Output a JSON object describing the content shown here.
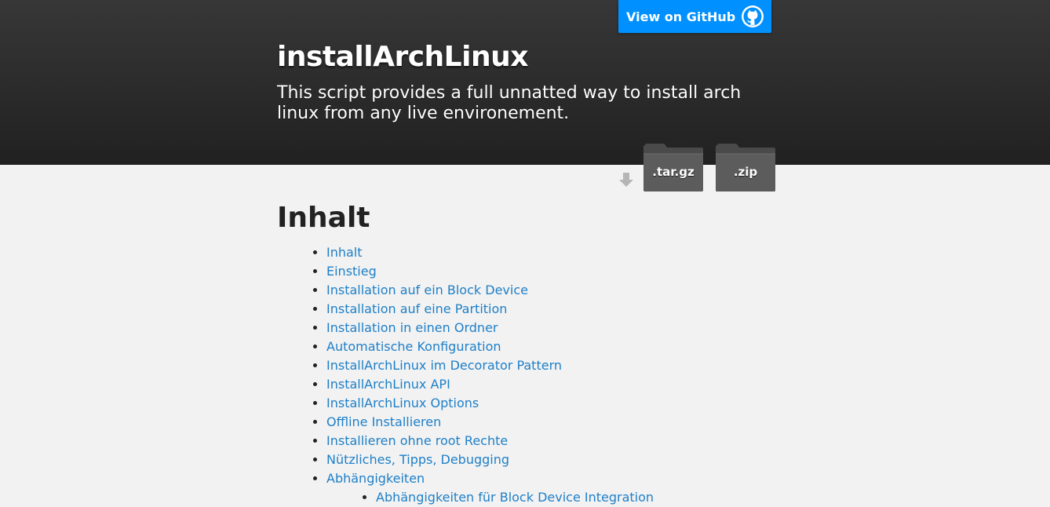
{
  "header": {
    "title": "installArchLinux",
    "tagline": "This script provides a full unnatted way to install arch linux from any live environement.",
    "github_button": {
      "label": "View on GitHub",
      "icon": "github-octocat-icon"
    },
    "downloads": [
      {
        "label": ".tar.gz",
        "icon": "folder-icon"
      },
      {
        "label": ".zip",
        "icon": "folder-icon"
      }
    ],
    "download_arrow_icon": "download-arrow-icon",
    "colors": {
      "header_bg": "#2b2b2b",
      "github_blue": "#0090ff",
      "link": "#1e7fc8",
      "page_bg": "#f2f2f2"
    }
  },
  "content": {
    "heading": "Inhalt",
    "toc": [
      "Inhalt",
      "Einstieg",
      "Installation auf ein Block Device",
      "Installation auf eine Partition",
      "Installation in einen Ordner",
      "Automatische Konfiguration",
      "InstallArchLinux im Decorator Pattern",
      "InstallArchLinux API",
      "InstallArchLinux Options",
      "Offline Installieren",
      "Installieren ohne root Rechte",
      "Nützliches, Tipps, Debugging",
      "Abhängigkeiten"
    ],
    "toc_sub": [
      "Abhängigkeiten für Block Device Integration"
    ]
  }
}
